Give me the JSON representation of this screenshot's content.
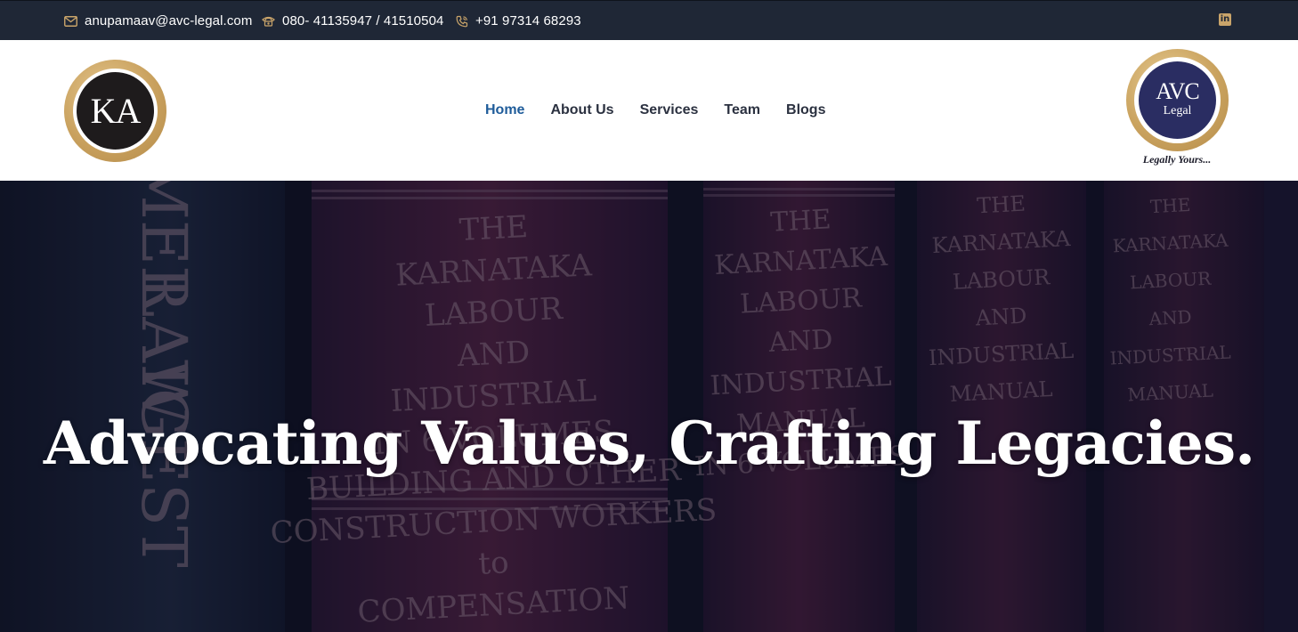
{
  "topbar": {
    "email": "anupamaav@avc-legal.com",
    "phone": "080- 41135947 / 41510504",
    "mobile": "+91 97314 68293",
    "social_icon": "linkedin-icon",
    "icons": {
      "email": "envelope-icon",
      "phone": "telephone-icon",
      "mobile": "phone-call-icon"
    },
    "colors": {
      "background": "#1f2736",
      "accent": "#c9a46a",
      "text": "#ffffff"
    }
  },
  "header": {
    "left_logo": {
      "text": "KA"
    },
    "nav": [
      {
        "label": "Home",
        "active": true
      },
      {
        "label": "About Us",
        "active": false
      },
      {
        "label": "Services",
        "active": false
      },
      {
        "label": "Team",
        "active": false
      },
      {
        "label": "Blogs",
        "active": false
      }
    ],
    "right_logo": {
      "line1": "AVC",
      "line2": "Legal",
      "tagline": "Legally Yours..."
    },
    "colors": {
      "nav_text": "#2b3140",
      "nav_active": "#1f5c9a",
      "logo_gold": "#c9a15e",
      "avc_navy": "#2a2d62"
    }
  },
  "hero": {
    "headline": "Advocating Values, Crafting Legacies.",
    "book_spines": [
      {
        "lines": [
          "MER",
          "LAW",
          "IGEST"
        ]
      },
      {
        "lines": [
          "THE",
          "KARNATAKA",
          "LABOUR",
          "AND",
          "INDUSTRIAL",
          "IN 6 VOLUMES",
          "BUILDING AND OTHER",
          "CONSTRUCTION WORKERS",
          "to",
          "COMPENSATION"
        ]
      },
      {
        "lines": [
          "THE",
          "KARNATAKA",
          "LABOUR",
          "AND",
          "INDUSTRIAL",
          "MANUAL",
          "IN 6 VOLUMES"
        ]
      },
      {
        "lines": [
          "THE",
          "KARNATAKA",
          "LABOUR",
          "AND",
          "INDUSTRIAL",
          "MANUAL"
        ]
      },
      {
        "lines": [
          "THE",
          "KARNATAKA",
          "LABOUR",
          "AND",
          "INDUSTRIAL",
          "MANUAL"
        ]
      }
    ]
  }
}
